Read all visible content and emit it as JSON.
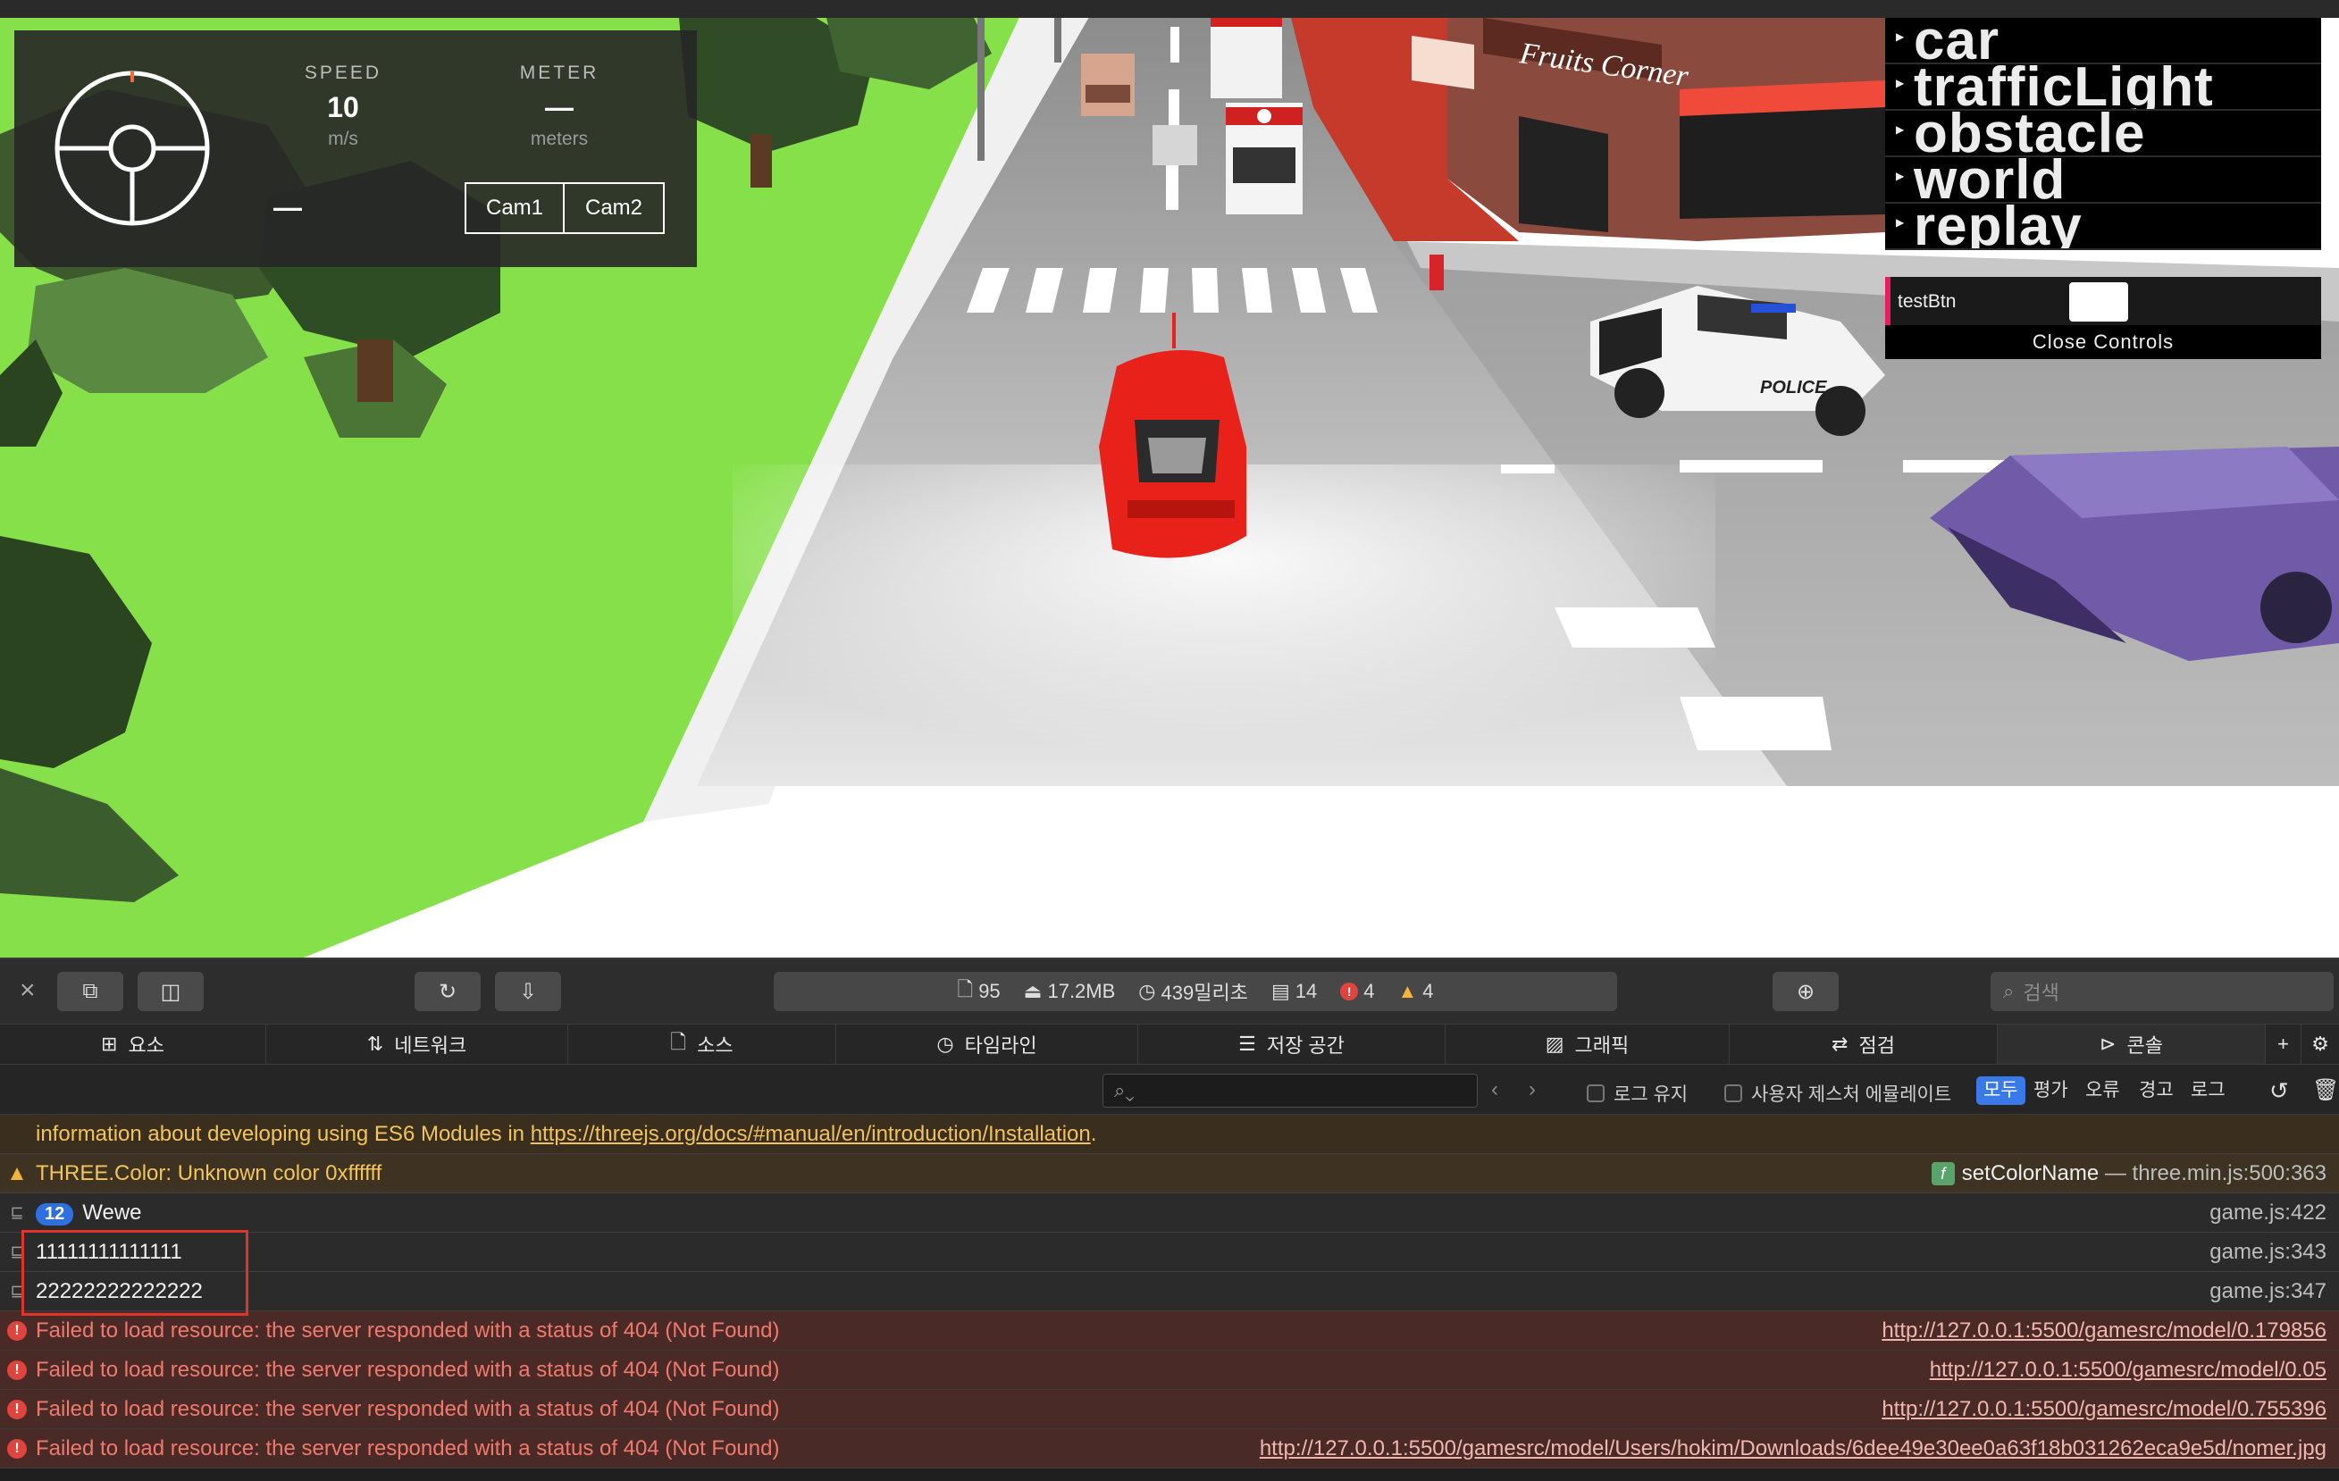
{
  "hud": {
    "speed_label": "SPEED",
    "speed_value": "10",
    "speed_unit": "m/s",
    "meter_label": "METER",
    "meter_value": "—",
    "meter_unit": "meters",
    "steer_value": "—",
    "cam1": "Cam1",
    "cam2": "Cam2"
  },
  "gui": {
    "folders": [
      "car",
      "trafficLight",
      "obstacle",
      "world",
      "replay"
    ],
    "test_label": "testBtn",
    "close": "Close Controls"
  },
  "scene_text": {
    "shop_sign": "Fruits Corner",
    "police": "POLICE"
  },
  "devtools": {
    "stats": {
      "resources": "95",
      "size": "17.2MB",
      "time": "439밀리초",
      "logs": "14",
      "errors": "4",
      "warnings": "4"
    },
    "search_placeholder": "검색",
    "tabs": [
      "요소",
      "네트워크",
      "소스",
      "타임라인",
      "저장 공간",
      "그래픽",
      "점검",
      "콘솔"
    ],
    "selected_tab": "콘솔",
    "filter_placeholder": "",
    "preserve_log": "로그 유지",
    "emulate_gesture": "사용자 제스처 에뮬레이트",
    "levels": [
      "모두",
      "평가",
      "오류",
      "경고",
      "로그"
    ],
    "selected_level": "모두"
  },
  "console": {
    "rows": [
      {
        "kind": "info",
        "text": "information about developing using ES6 Modules in ",
        "link": "https://threejs.org/docs/#manual/en/introduction/Installation",
        "tail": ".",
        "source": ""
      },
      {
        "kind": "warn",
        "text": "THREE.Color: Unknown color 0xffffff",
        "fn": "setColorName",
        "source": "— three.min.js:500:363"
      },
      {
        "kind": "log",
        "badge": "12",
        "text": "Wewe",
        "source": "game.js:422"
      },
      {
        "kind": "log",
        "text": "11111111111111",
        "source": "game.js:343"
      },
      {
        "kind": "log",
        "text": "22222222222222",
        "source": "game.js:347"
      },
      {
        "kind": "err",
        "text": "Failed to load resource: the server responded with a status of 404 (Not Found)",
        "source": "http://127.0.0.1:5500/gamesrc/model/0.179856"
      },
      {
        "kind": "err",
        "text": "Failed to load resource: the server responded with a status of 404 (Not Found)",
        "source": "http://127.0.0.1:5500/gamesrc/model/0.05"
      },
      {
        "kind": "err",
        "text": "Failed to load resource: the server responded with a status of 404 (Not Found)",
        "source": "http://127.0.0.1:5500/gamesrc/model/0.755396"
      },
      {
        "kind": "err",
        "text": "Failed to load resource: the server responded with a status of 404 (Not Found)",
        "source": "http://127.0.0.1:5500/gamesrc/model/Users/hokim/Downloads/6dee49e30ee0a63f18b031262eca9e5d/nomer.jpg"
      }
    ]
  },
  "colors": {
    "grass": "#86e04a",
    "road": "#8e8e8e",
    "car": "#e8221a",
    "gui_accent": "#e61d5f",
    "selected_level": "#3a7ae8",
    "highlight_box": "#e0342a"
  }
}
